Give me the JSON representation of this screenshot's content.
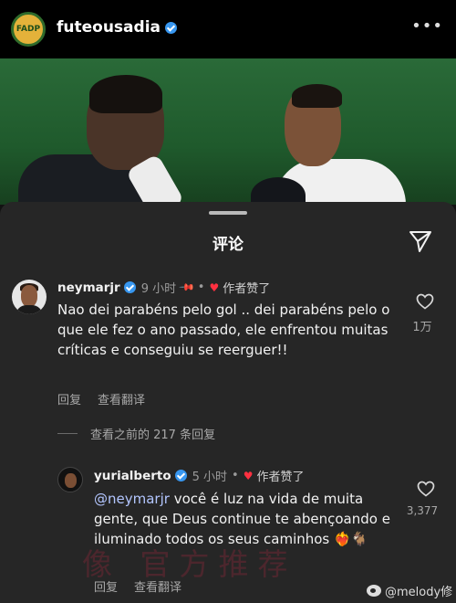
{
  "header": {
    "account_name": "futeousadia",
    "avatar_text": "FADP",
    "more_icon": "more-horizontal-icon"
  },
  "sheet": {
    "title": "评论",
    "share_icon": "send-icon"
  },
  "comments": [
    {
      "username": "neymarjr",
      "time": "9 小时",
      "pinned": true,
      "liked_by_author": "作者赞了",
      "text": "Nao dei parabéns pelo gol .. dei parabéns pelo o que ele fez o ano passado, ele enfrentou muitas críticas e conseguiu se reerguer!!",
      "reply_label": "回复",
      "translate_label": "查看翻译",
      "like_count": "1万"
    },
    {
      "username": "yurialberto",
      "time": "5 小时",
      "liked_by_author": "作者赞了",
      "mention": "@neymarjr",
      "text": " você é luz na vida de muita gente, que Deus continue te abençoando e iluminado todos os seus caminhos ❤️‍🔥🐐",
      "reply_label": "回复",
      "translate_label": "查看翻译",
      "like_count": "3,377"
    }
  ],
  "view_replies": "查看之前的 217 条回复",
  "watermark": "像 官方推荐",
  "source_tag": "@melody修",
  "colors": {
    "sheet_bg": "#262626",
    "like_red": "#ff3040",
    "verified_blue": "#3897f0",
    "mention": "#b3c6ff"
  }
}
